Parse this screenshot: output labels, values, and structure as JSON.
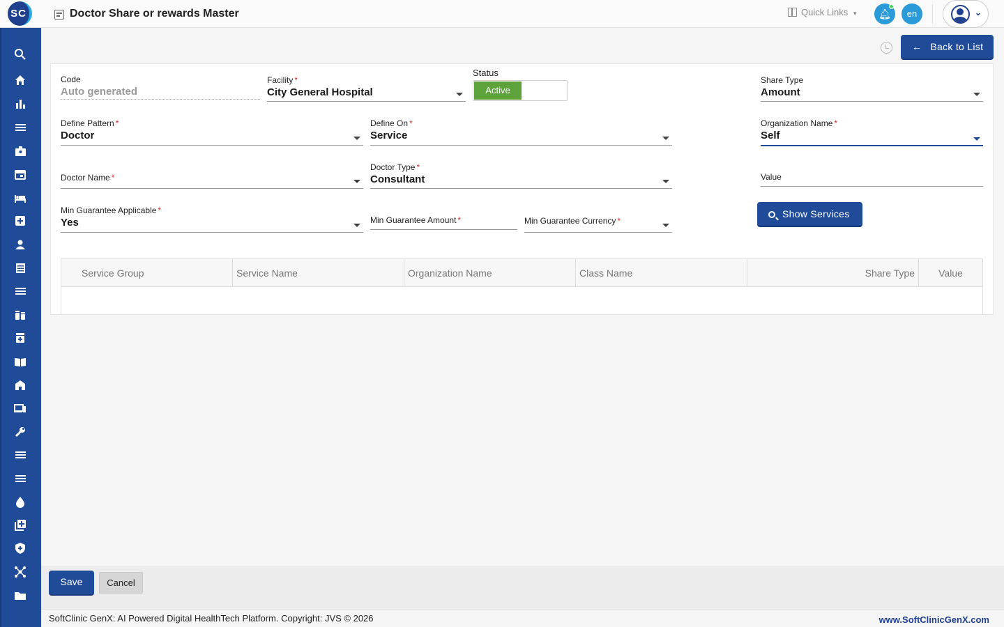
{
  "app": {
    "logo_text": "SC",
    "page_title": "Doctor Share or rewards Master",
    "quick_links": "Quick Links",
    "language": "en",
    "accent_color": "#1f4b99"
  },
  "actions": {
    "back_to_list": "Back to List",
    "show_services": "Show Services",
    "save": "Save",
    "cancel": "Cancel"
  },
  "form": {
    "code": {
      "label": "Code",
      "value": "Auto generated"
    },
    "facility": {
      "label": "Facility",
      "value": "City General Hospital"
    },
    "status": {
      "label": "Status",
      "value": "Active"
    },
    "share_type": {
      "label": "Share Type",
      "value": "Amount"
    },
    "define_pattern": {
      "label": "Define Pattern",
      "value": "Doctor"
    },
    "define_on": {
      "label": "Define On",
      "value": "Service"
    },
    "organization_name": {
      "label": "Organization Name",
      "value": "Self"
    },
    "doctor_name": {
      "label": "Doctor Name",
      "value": ""
    },
    "doctor_type": {
      "label": "Doctor Type",
      "value": "Consultant"
    },
    "value": {
      "label": "Value",
      "value": ""
    },
    "min_guarantee_applicable": {
      "label": "Min Guarantee Applicable",
      "value": "Yes"
    },
    "min_guarantee_amount": {
      "label": "Min Guarantee Amount",
      "value": ""
    },
    "min_guarantee_currency": {
      "label": "Min Guarantee Currency",
      "value": ""
    }
  },
  "table": {
    "columns": [
      "Service Group",
      "Service Name",
      "Organization Name",
      "Class Name",
      "Share Type",
      "Value"
    ],
    "rows": []
  },
  "sidebar": {
    "icons": [
      "search-icon",
      "home-icon",
      "analytics-icon",
      "menu-icon",
      "badge-icon",
      "calendar-icon",
      "bed-icon",
      "medical-plus-icon",
      "person-icon",
      "document-list-icon",
      "menu-icon",
      "medication-icon",
      "pharmacy-icon",
      "book-icon",
      "building-icon",
      "devices-icon",
      "wrench-icon",
      "menu-icon",
      "menu-icon",
      "blood-drop-icon",
      "add-library-icon",
      "shield-icon",
      "network-icon",
      "folder-icon"
    ]
  },
  "footer": {
    "copyright": "SoftClinic GenX: AI Powered Digital HealthTech Platform. Copyright: JVS © 2026",
    "website": "www.SoftClinicGenX.com"
  }
}
